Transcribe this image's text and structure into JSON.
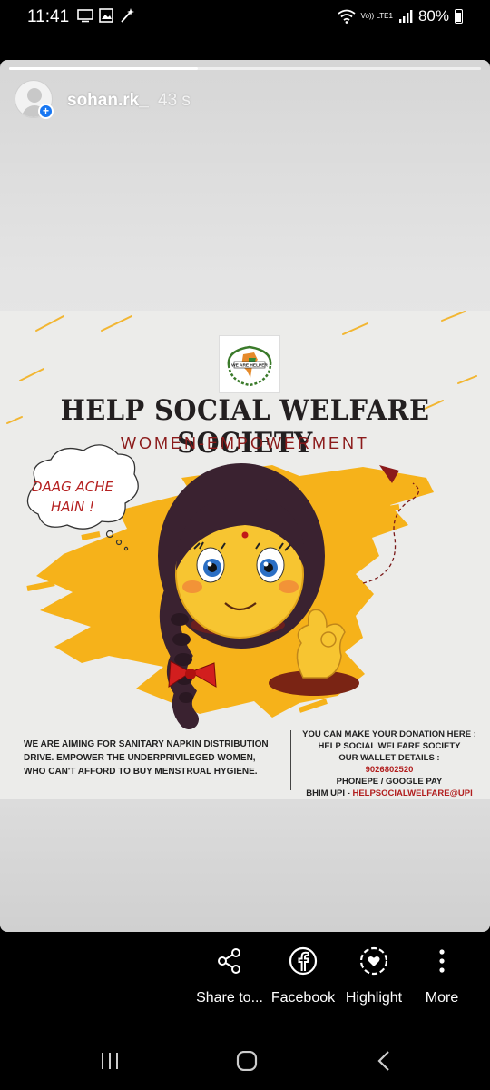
{
  "status_bar": {
    "time": "11:41",
    "network": "Vo)) LTE1",
    "battery": "80%",
    "icons_left": [
      "screen-mirror-icon",
      "image-icon",
      "magic-wand-icon"
    ],
    "icons_right": [
      "wifi-icon",
      "signal-icon",
      "battery-icon"
    ]
  },
  "story": {
    "username": "sohan.rk_",
    "time_ago": "43 s",
    "progress": 0.4
  },
  "poster": {
    "logo_text": "WE ARE HELPER",
    "title": "HELP SOCIAL WELFARE SOCIETY",
    "subtitle": "WOMEN-EMPOWERMENT",
    "bubble_line1": "DAAG ACHE",
    "bubble_line2": "HAIN !",
    "left_line1": "WE ARE AIMING FOR SANITARY NAPKIN DISTRIBUTION",
    "left_line2": "DRIVE. EMPOWER THE UNDERPRIVILEGED WOMEN,",
    "left_line3": "WHO CAN'T AFFORD TO BUY MENSTRUAL HYGIENE.",
    "donate_line1": "YOU CAN MAKE YOUR DONATION HERE :",
    "donate_line2": "HELP SOCIAL WELFARE SOCIETY",
    "donate_line3": "OUR WALLET DETAILS :",
    "phone": "9026802520",
    "payment_methods": "PHONEPE / GOOGLE PAY",
    "upi_label": "BHIM UPI - ",
    "upi_id": "HELPSOCIALWELFARE@UPI",
    "colors": {
      "accent_yellow": "#f6b21a",
      "brand_red": "#b21e1e",
      "title_dark": "#231f20"
    }
  },
  "actions": {
    "share": "Share to...",
    "facebook": "Facebook",
    "highlight": "Highlight",
    "more": "More"
  },
  "nav": [
    "recent-apps-icon",
    "home-icon",
    "back-icon"
  ]
}
